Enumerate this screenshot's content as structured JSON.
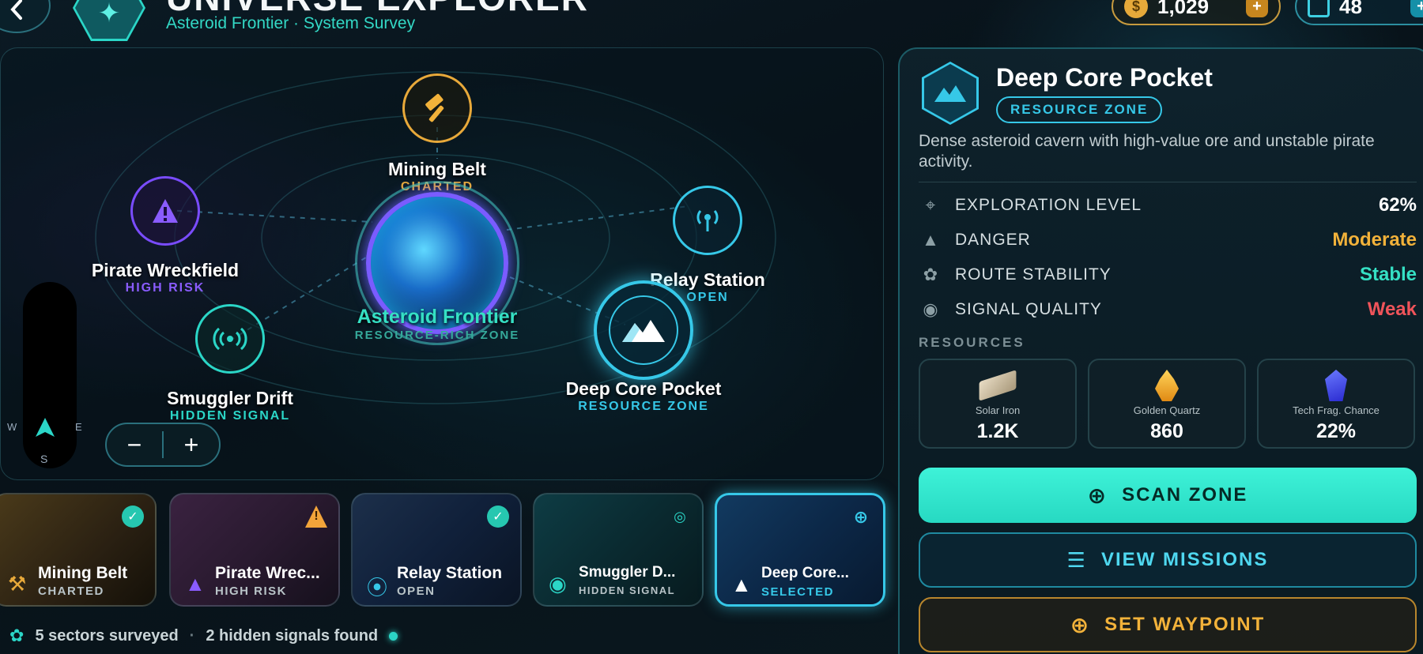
{
  "header": {
    "title": "UNIVERSE EXPLORER",
    "subtitle": "Asteroid Frontier · System Survey",
    "credits": "1,029",
    "chips": "48"
  },
  "map": {
    "center": {
      "name": "Asteroid Frontier",
      "sub": "RESOURCE-RICH ZONE"
    },
    "nodes": [
      {
        "name": "Mining Belt",
        "sub": "CHARTED",
        "color": "#e8a93a",
        "icon": "hammer-icon"
      },
      {
        "name": "Pirate Wreckfield",
        "sub": "HIGH RISK",
        "color": "#7a4cff",
        "icon": "warning-icon"
      },
      {
        "name": "Relay Station",
        "sub": "OPEN",
        "color": "#36c8e8",
        "icon": "antenna-icon"
      },
      {
        "name": "Smuggler Drift",
        "sub": "HIDDEN SIGNAL",
        "color": "#2bd6c7",
        "icon": "signal-icon"
      },
      {
        "name": "Deep Core Pocket",
        "sub": "RESOURCE ZONE",
        "color": "#36c8e8",
        "icon": "mountains-icon"
      }
    ],
    "compass": {
      "w": "W",
      "e": "E",
      "s": "S"
    },
    "zoom_out": "−",
    "zoom_in": "+"
  },
  "cards": [
    {
      "title": "Mining Belt",
      "status": "CHARTED",
      "badge": "✓"
    },
    {
      "title": "Pirate Wrec...",
      "status": "HIGH RISK",
      "badge": "!"
    },
    {
      "title": "Relay Station",
      "status": "OPEN",
      "badge": "✓"
    },
    {
      "title": "Smuggler D...",
      "status": "HIDDEN SIGNAL",
      "badge": ""
    },
    {
      "title": "Deep Core...",
      "status": "SELECTED",
      "badge": ""
    }
  ],
  "footer": {
    "sectors": "5 sectors surveyed",
    "dot": "·",
    "signals": "2 hidden signals found"
  },
  "detail": {
    "title": "Deep Core Pocket",
    "badge": "RESOURCE ZONE",
    "description": "Dense asteroid cavern with high-value ore and unstable pirate activity.",
    "stats": [
      {
        "label": "EXPLORATION LEVEL",
        "value": "62%",
        "color": "#ffffff"
      },
      {
        "label": "DANGER",
        "value": "Moderate",
        "color": "#f2b23a"
      },
      {
        "label": "ROUTE STABILITY",
        "value": "Stable",
        "color": "#35e0c4"
      },
      {
        "label": "SIGNAL QUALITY",
        "value": "Weak",
        "color": "#f0545a"
      }
    ],
    "resources_heading": "RESOURCES",
    "resources": [
      {
        "name": "Solar Iron",
        "value": "1.2K"
      },
      {
        "name": "Golden Quartz",
        "value": "860"
      },
      {
        "name": "Tech Frag. Chance",
        "value": "22%"
      }
    ],
    "buttons": {
      "scan": "SCAN ZONE",
      "missions": "VIEW MISSIONS",
      "waypoint": "SET WAYPOINT"
    }
  }
}
